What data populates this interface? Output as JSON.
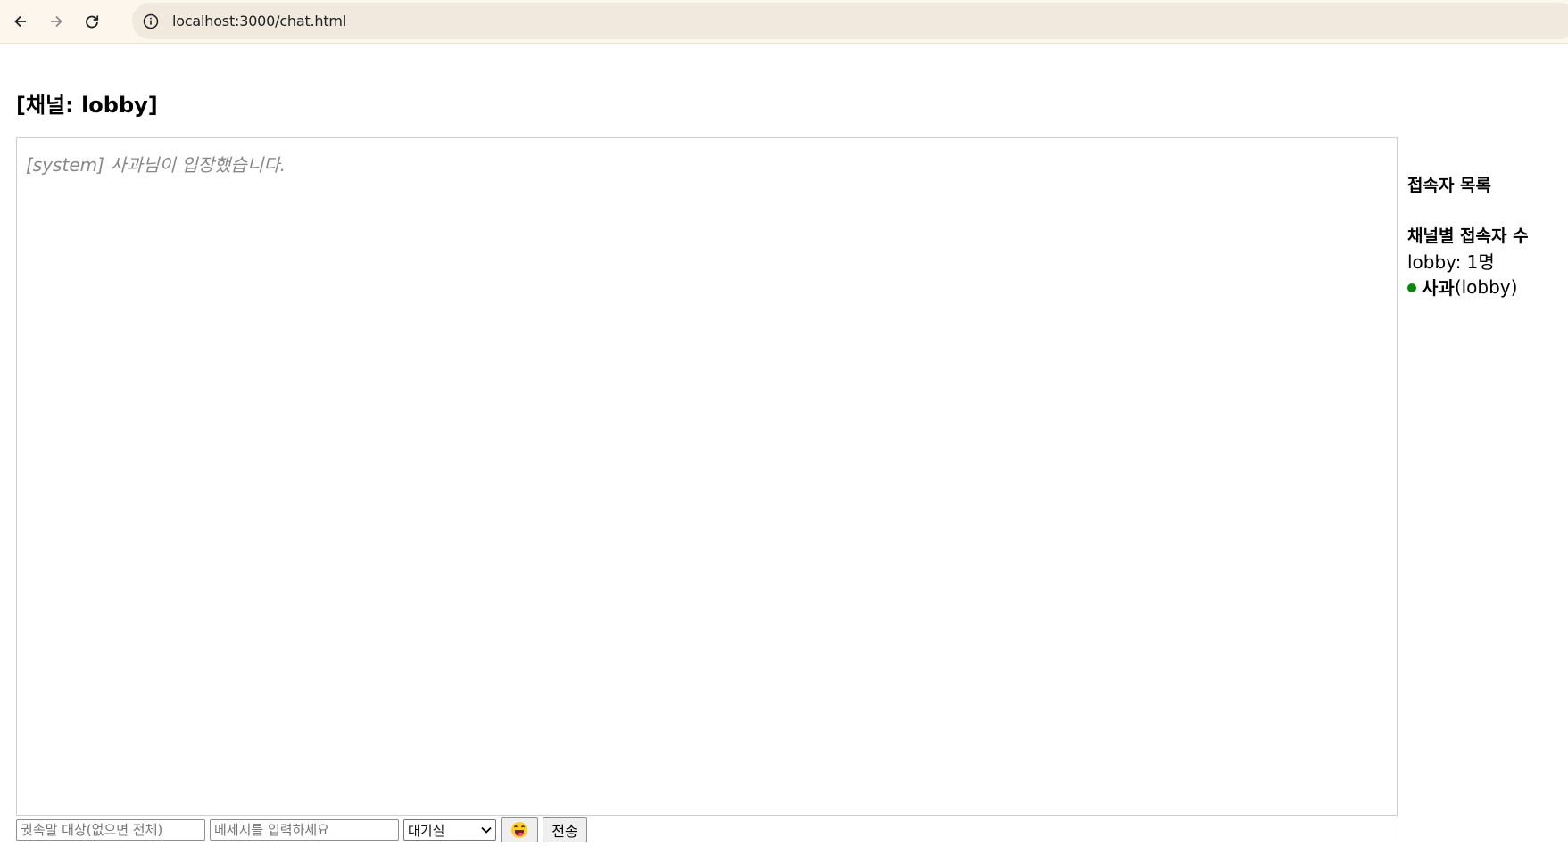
{
  "browser": {
    "url": "localhost:3000/chat.html",
    "icons": {
      "back": "arrow-left-icon",
      "forward": "arrow-right-icon",
      "reload": "reload-icon",
      "info": "info-icon"
    }
  },
  "channel": {
    "title": "[채널: lobby]"
  },
  "chat": {
    "messages": [
      {
        "text": "[system] 사과님이 입장했습니다."
      }
    ]
  },
  "sidebar": {
    "users_heading": "접속자 목록",
    "channel_counts_heading": "채널별 접속자 수",
    "channel_count_line": "lobby: 1명",
    "users": [
      {
        "name": "사과",
        "channel": "(lobby)",
        "status_color": "#0a8a0a"
      }
    ]
  },
  "input": {
    "whisper_placeholder": "귓속말 대상(없으면 전체)",
    "message_placeholder": "메세지를 입력하세요",
    "channel_select_value": "대기실",
    "emoji_icon": "grinning-squinting-face-icon",
    "send_label": "전송"
  }
}
